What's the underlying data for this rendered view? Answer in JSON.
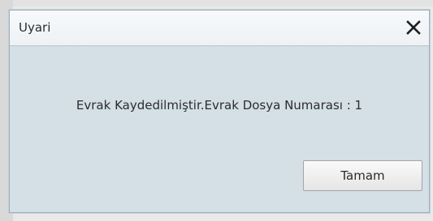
{
  "dialog": {
    "title": "Uyari",
    "close_icon": "close-icon",
    "message": "Evrak Kaydedilmiştir.Evrak Dosya Numarası : 1",
    "ok_label": "Tamam"
  }
}
